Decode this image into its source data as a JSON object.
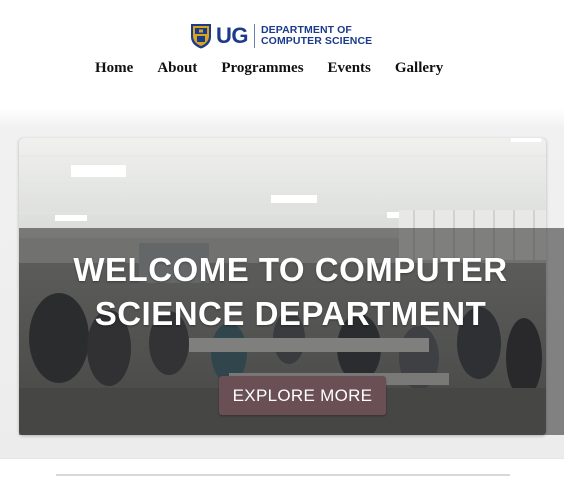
{
  "brand": {
    "logo_text": "UG",
    "department_line1": "DEPARTMENT OF",
    "department_line2": "COMPUTER SCIENCE",
    "colors": {
      "primary": "#1c3a8a",
      "crest_gold": "#d9a520"
    }
  },
  "nav": {
    "items": [
      {
        "label": "Home"
      },
      {
        "label": "About"
      },
      {
        "label": "Programmes"
      },
      {
        "label": "Events"
      },
      {
        "label": "Gallery"
      }
    ]
  },
  "hero": {
    "title_line1": "WELCOME TO COMPUTER",
    "title_line2": "SCIENCE DEPARTMENT",
    "button_label": "EXPLORE MORE",
    "button_color": "#6a5055",
    "overlay_color": "#282828"
  }
}
